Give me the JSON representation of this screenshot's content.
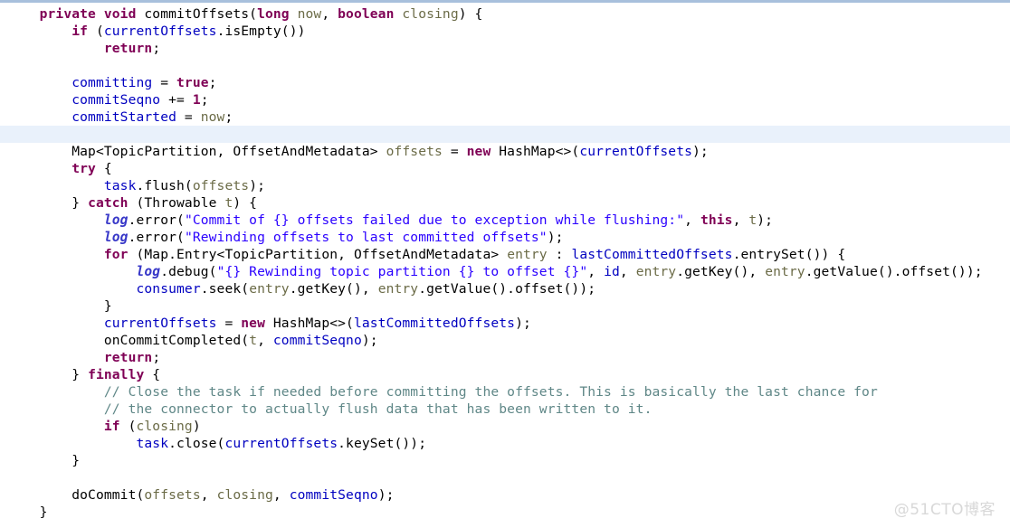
{
  "editor": {
    "language": "java",
    "theme": "eclipse-light",
    "background_color": "#ffffff",
    "highlight_line_color": "#e9f1fb",
    "top_border_color": "#a8c0dc",
    "colors": {
      "keyword": "#7f0055",
      "string": "#2a00ff",
      "comment": "#5f8787",
      "field": "#0000c0",
      "static_field": "#3737c8",
      "parameter": "#6b6b47",
      "plain": "#000000"
    }
  },
  "watermark": {
    "text": "@51CTO博客"
  },
  "code": {
    "lines": [
      {
        "n": 1,
        "highlight": false,
        "text": "    private void commitOffsets(long now, boolean closing) {"
      },
      {
        "n": 2,
        "highlight": false,
        "text": "        if (currentOffsets.isEmpty())"
      },
      {
        "n": 3,
        "highlight": false,
        "text": "            return;"
      },
      {
        "n": 4,
        "highlight": false,
        "text": ""
      },
      {
        "n": 5,
        "highlight": false,
        "text": "        committing = true;"
      },
      {
        "n": 6,
        "highlight": false,
        "text": "        commitSeqno += 1;"
      },
      {
        "n": 7,
        "highlight": false,
        "text": "        commitStarted = now;"
      },
      {
        "n": 8,
        "highlight": true,
        "text": ""
      },
      {
        "n": 9,
        "highlight": false,
        "text": "        Map<TopicPartition, OffsetAndMetadata> offsets = new HashMap<>(currentOffsets);"
      },
      {
        "n": 10,
        "highlight": false,
        "text": "        try {"
      },
      {
        "n": 11,
        "highlight": false,
        "text": "            task.flush(offsets);"
      },
      {
        "n": 12,
        "highlight": false,
        "text": "        } catch (Throwable t) {"
      },
      {
        "n": 13,
        "highlight": false,
        "text": "            log.error(\"Commit of {} offsets failed due to exception while flushing:\", this, t);"
      },
      {
        "n": 14,
        "highlight": false,
        "text": "            log.error(\"Rewinding offsets to last committed offsets\");"
      },
      {
        "n": 15,
        "highlight": false,
        "text": "            for (Map.Entry<TopicPartition, OffsetAndMetadata> entry : lastCommittedOffsets.entrySet()) {"
      },
      {
        "n": 16,
        "highlight": false,
        "text": "                log.debug(\"{} Rewinding topic partition {} to offset {}\", id, entry.getKey(), entry.getValue().offset());"
      },
      {
        "n": 17,
        "highlight": false,
        "text": "                consumer.seek(entry.getKey(), entry.getValue().offset());"
      },
      {
        "n": 18,
        "highlight": false,
        "text": "            }"
      },
      {
        "n": 19,
        "highlight": false,
        "text": "            currentOffsets = new HashMap<>(lastCommittedOffsets);"
      },
      {
        "n": 20,
        "highlight": false,
        "text": "            onCommitCompleted(t, commitSeqno);"
      },
      {
        "n": 21,
        "highlight": false,
        "text": "            return;"
      },
      {
        "n": 22,
        "highlight": false,
        "text": "        } finally {"
      },
      {
        "n": 23,
        "highlight": false,
        "text": "            // Close the task if needed before committing the offsets. This is basically the last chance for"
      },
      {
        "n": 24,
        "highlight": false,
        "text": "            // the connector to actually flush data that has been written to it."
      },
      {
        "n": 25,
        "highlight": false,
        "text": "            if (closing)"
      },
      {
        "n": 26,
        "highlight": false,
        "text": "                task.close(currentOffsets.keySet());"
      },
      {
        "n": 27,
        "highlight": false,
        "text": "        }"
      },
      {
        "n": 28,
        "highlight": false,
        "text": ""
      },
      {
        "n": 29,
        "highlight": false,
        "text": "        doCommit(offsets, closing, commitSeqno);"
      },
      {
        "n": 30,
        "highlight": false,
        "text": "    }"
      }
    ],
    "tokens": [
      [
        {
          "t": "    ",
          "c": "pl"
        },
        {
          "t": "private",
          "c": "kw"
        },
        {
          "t": " ",
          "c": "pl"
        },
        {
          "t": "void",
          "c": "kw"
        },
        {
          "t": " commitOffsets(",
          "c": "pl"
        },
        {
          "t": "long",
          "c": "kw"
        },
        {
          "t": " ",
          "c": "pl"
        },
        {
          "t": "now",
          "c": "par"
        },
        {
          "t": ", ",
          "c": "pl"
        },
        {
          "t": "boolean",
          "c": "kw"
        },
        {
          "t": " ",
          "c": "pl"
        },
        {
          "t": "closing",
          "c": "par"
        },
        {
          "t": ") {",
          "c": "pl"
        }
      ],
      [
        {
          "t": "        ",
          "c": "pl"
        },
        {
          "t": "if",
          "c": "kw"
        },
        {
          "t": " (",
          "c": "pl"
        },
        {
          "t": "currentOffsets",
          "c": "fld"
        },
        {
          "t": ".isEmpty())",
          "c": "pl"
        }
      ],
      [
        {
          "t": "            ",
          "c": "pl"
        },
        {
          "t": "return",
          "c": "kw"
        },
        {
          "t": ";",
          "c": "pl"
        }
      ],
      [
        {
          "t": "",
          "c": "pl"
        }
      ],
      [
        {
          "t": "        ",
          "c": "pl"
        },
        {
          "t": "committing",
          "c": "fld"
        },
        {
          "t": " = ",
          "c": "pl"
        },
        {
          "t": "true",
          "c": "kw"
        },
        {
          "t": ";",
          "c": "pl"
        }
      ],
      [
        {
          "t": "        ",
          "c": "pl"
        },
        {
          "t": "commitSeqno",
          "c": "fld"
        },
        {
          "t": " += ",
          "c": "pl"
        },
        {
          "t": "1",
          "c": "num"
        },
        {
          "t": ";",
          "c": "pl"
        }
      ],
      [
        {
          "t": "        ",
          "c": "pl"
        },
        {
          "t": "commitStarted",
          "c": "fld"
        },
        {
          "t": " = ",
          "c": "pl"
        },
        {
          "t": "now",
          "c": "par"
        },
        {
          "t": ";",
          "c": "pl"
        }
      ],
      [
        {
          "t": "",
          "c": "pl"
        }
      ],
      [
        {
          "t": "        Map<TopicPartition, OffsetAndMetadata> ",
          "c": "pl"
        },
        {
          "t": "offsets",
          "c": "par"
        },
        {
          "t": " = ",
          "c": "pl"
        },
        {
          "t": "new",
          "c": "kw"
        },
        {
          "t": " HashMap<>(",
          "c": "pl"
        },
        {
          "t": "currentOffsets",
          "c": "fld"
        },
        {
          "t": ");",
          "c": "pl"
        }
      ],
      [
        {
          "t": "        ",
          "c": "pl"
        },
        {
          "t": "try",
          "c": "kw"
        },
        {
          "t": " {",
          "c": "pl"
        }
      ],
      [
        {
          "t": "            ",
          "c": "pl"
        },
        {
          "t": "task",
          "c": "fld"
        },
        {
          "t": ".flush(",
          "c": "pl"
        },
        {
          "t": "offsets",
          "c": "par"
        },
        {
          "t": ");",
          "c": "pl"
        }
      ],
      [
        {
          "t": "        } ",
          "c": "pl"
        },
        {
          "t": "catch",
          "c": "kw"
        },
        {
          "t": " (Throwable ",
          "c": "pl"
        },
        {
          "t": "t",
          "c": "par"
        },
        {
          "t": ") {",
          "c": "pl"
        }
      ],
      [
        {
          "t": "            ",
          "c": "pl"
        },
        {
          "t": "log",
          "c": "sfld"
        },
        {
          "t": ".error(",
          "c": "pl"
        },
        {
          "t": "\"Commit of {} offsets failed due to exception while flushing:\"",
          "c": "str"
        },
        {
          "t": ", ",
          "c": "pl"
        },
        {
          "t": "this",
          "c": "kw"
        },
        {
          "t": ", ",
          "c": "pl"
        },
        {
          "t": "t",
          "c": "par"
        },
        {
          "t": ");",
          "c": "pl"
        }
      ],
      [
        {
          "t": "            ",
          "c": "pl"
        },
        {
          "t": "log",
          "c": "sfld"
        },
        {
          "t": ".error(",
          "c": "pl"
        },
        {
          "t": "\"Rewinding offsets to last committed offsets\"",
          "c": "str"
        },
        {
          "t": ");",
          "c": "pl"
        }
      ],
      [
        {
          "t": "            ",
          "c": "pl"
        },
        {
          "t": "for",
          "c": "kw"
        },
        {
          "t": " (Map.Entry<TopicPartition, OffsetAndMetadata> ",
          "c": "pl"
        },
        {
          "t": "entry",
          "c": "par"
        },
        {
          "t": " : ",
          "c": "pl"
        },
        {
          "t": "lastCommittedOffsets",
          "c": "fld"
        },
        {
          "t": ".entrySet()) {",
          "c": "pl"
        }
      ],
      [
        {
          "t": "                ",
          "c": "pl"
        },
        {
          "t": "log",
          "c": "sfld"
        },
        {
          "t": ".debug(",
          "c": "pl"
        },
        {
          "t": "\"{} Rewinding topic partition {} to offset {}\"",
          "c": "str"
        },
        {
          "t": ", ",
          "c": "pl"
        },
        {
          "t": "id",
          "c": "fld"
        },
        {
          "t": ", ",
          "c": "pl"
        },
        {
          "t": "entry",
          "c": "par"
        },
        {
          "t": ".getKey(), ",
          "c": "pl"
        },
        {
          "t": "entry",
          "c": "par"
        },
        {
          "t": ".getValue().offset());",
          "c": "pl"
        }
      ],
      [
        {
          "t": "                ",
          "c": "pl"
        },
        {
          "t": "consumer",
          "c": "fld"
        },
        {
          "t": ".seek(",
          "c": "pl"
        },
        {
          "t": "entry",
          "c": "par"
        },
        {
          "t": ".getKey(), ",
          "c": "pl"
        },
        {
          "t": "entry",
          "c": "par"
        },
        {
          "t": ".getValue().offset());",
          "c": "pl"
        }
      ],
      [
        {
          "t": "            }",
          "c": "pl"
        }
      ],
      [
        {
          "t": "            ",
          "c": "pl"
        },
        {
          "t": "currentOffsets",
          "c": "fld"
        },
        {
          "t": " = ",
          "c": "pl"
        },
        {
          "t": "new",
          "c": "kw"
        },
        {
          "t": " HashMap<>(",
          "c": "pl"
        },
        {
          "t": "lastCommittedOffsets",
          "c": "fld"
        },
        {
          "t": ");",
          "c": "pl"
        }
      ],
      [
        {
          "t": "            onCommitCompleted(",
          "c": "pl"
        },
        {
          "t": "t",
          "c": "par"
        },
        {
          "t": ", ",
          "c": "pl"
        },
        {
          "t": "commitSeqno",
          "c": "fld"
        },
        {
          "t": ");",
          "c": "pl"
        }
      ],
      [
        {
          "t": "            ",
          "c": "pl"
        },
        {
          "t": "return",
          "c": "kw"
        },
        {
          "t": ";",
          "c": "pl"
        }
      ],
      [
        {
          "t": "        } ",
          "c": "pl"
        },
        {
          "t": "finally",
          "c": "kw"
        },
        {
          "t": " {",
          "c": "pl"
        }
      ],
      [
        {
          "t": "            ",
          "c": "pl"
        },
        {
          "t": "// Close the task if needed before committing the offsets. This is basically the last chance for",
          "c": "cmt"
        }
      ],
      [
        {
          "t": "            ",
          "c": "pl"
        },
        {
          "t": "// the connector to actually flush data that has been written to it.",
          "c": "cmt"
        }
      ],
      [
        {
          "t": "            ",
          "c": "pl"
        },
        {
          "t": "if",
          "c": "kw"
        },
        {
          "t": " (",
          "c": "pl"
        },
        {
          "t": "closing",
          "c": "par"
        },
        {
          "t": ")",
          "c": "pl"
        }
      ],
      [
        {
          "t": "                ",
          "c": "pl"
        },
        {
          "t": "task",
          "c": "fld"
        },
        {
          "t": ".close(",
          "c": "pl"
        },
        {
          "t": "currentOffsets",
          "c": "fld"
        },
        {
          "t": ".keySet());",
          "c": "pl"
        }
      ],
      [
        {
          "t": "        }",
          "c": "pl"
        }
      ],
      [
        {
          "t": "",
          "c": "pl"
        }
      ],
      [
        {
          "t": "        doCommit(",
          "c": "pl"
        },
        {
          "t": "offsets",
          "c": "par"
        },
        {
          "t": ", ",
          "c": "pl"
        },
        {
          "t": "closing",
          "c": "par"
        },
        {
          "t": ", ",
          "c": "pl"
        },
        {
          "t": "commitSeqno",
          "c": "fld"
        },
        {
          "t": ");",
          "c": "pl"
        }
      ],
      [
        {
          "t": "    }",
          "c": "pl"
        }
      ]
    ]
  }
}
